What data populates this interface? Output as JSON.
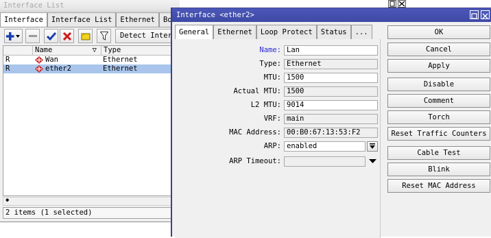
{
  "bg_window": {
    "title": "Interface List",
    "tabs": [
      "Interface",
      "Interface List",
      "Ethernet",
      "Bo"
    ],
    "detect_label": "Detect Inter",
    "columns": [
      "Name",
      "Type"
    ],
    "rows": [
      {
        "flag": "R",
        "name": "Wan",
        "type": "Ethernet"
      },
      {
        "flag": "R",
        "name": "ether2",
        "type": "Ethernet"
      }
    ],
    "status": "2 items (1 selected)"
  },
  "dialog": {
    "title": "Interface <ether2>",
    "tabs": [
      "General",
      "Ethernet",
      "Loop Protect",
      "Status",
      "..."
    ],
    "fields": {
      "name": {
        "label": "Name:",
        "value": "Lan"
      },
      "type": {
        "label": "Type:",
        "value": "Ethernet"
      },
      "mtu": {
        "label": "MTU:",
        "value": "1500"
      },
      "actual_mtu": {
        "label": "Actual MTU:",
        "value": "1500"
      },
      "l2_mtu": {
        "label": "L2 MTU:",
        "value": "9014"
      },
      "vrf": {
        "label": "VRF:",
        "value": "main"
      },
      "mac": {
        "label": "MAC Address:",
        "value": "00:B0:67:13:53:F2"
      },
      "arp": {
        "label": "ARP:",
        "value": "enabled"
      },
      "arp_timeout": {
        "label": "ARP Timeout:",
        "value": ""
      }
    },
    "buttons": [
      "OK",
      "Cancel",
      "Apply",
      "Disable",
      "Comment",
      "Torch",
      "Reset Traffic Counters",
      "Cable Test",
      "Blink",
      "Reset MAC Address"
    ]
  },
  "colors": {
    "dialog_title_bg": "#4552ae",
    "selected_row": "#a9c5eb",
    "name_label": "#2a2ad6"
  }
}
